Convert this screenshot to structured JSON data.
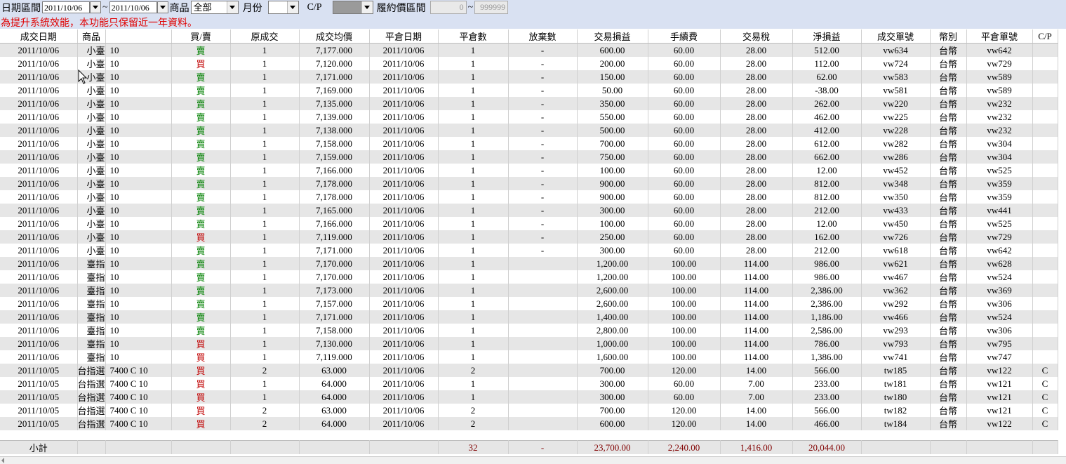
{
  "toolbar": {
    "date_range_label": "日期區間",
    "date_from": "2011/10/06",
    "tilde": "~",
    "date_to": "2011/10/06",
    "product_label": "商品",
    "product_value": "全部",
    "month_label": "月份",
    "month_value": "",
    "cp_label": "C/P",
    "cp_value": "",
    "strike_label": "履約價區間",
    "strike_from": "0",
    "strike_to": "999999"
  },
  "notice": "為提升系統效能，本功能只保留近一年資料。",
  "columns": [
    "成交日期",
    "商品",
    "",
    "買/賣",
    "原成交",
    "成交均價",
    "平倉日期",
    "平倉數",
    "放棄數",
    "交易損益",
    "手續費",
    "交易稅",
    "淨損益",
    "成交單號",
    "幣別",
    "平倉單號",
    "C/P"
  ],
  "rows": [
    [
      "2011/10/06",
      "小臺",
      "10",
      "賣",
      "1",
      "7,177.000",
      "2011/10/06",
      "1",
      "-",
      "600.00",
      "60.00",
      "28.00",
      "512.00",
      "vw634",
      "台幣",
      "vw642",
      ""
    ],
    [
      "2011/10/06",
      "小臺",
      "10",
      "買",
      "1",
      "7,120.000",
      "2011/10/06",
      "1",
      "-",
      "200.00",
      "60.00",
      "28.00",
      "112.00",
      "vw724",
      "台幣",
      "vw729",
      ""
    ],
    [
      "2011/10/06",
      "小臺",
      "10",
      "賣",
      "1",
      "7,171.000",
      "2011/10/06",
      "1",
      "-",
      "150.00",
      "60.00",
      "28.00",
      "62.00",
      "vw583",
      "台幣",
      "vw589",
      ""
    ],
    [
      "2011/10/06",
      "小臺",
      "10",
      "賣",
      "1",
      "7,169.000",
      "2011/10/06",
      "1",
      "-",
      "50.00",
      "60.00",
      "28.00",
      "-38.00",
      "vw581",
      "台幣",
      "vw589",
      ""
    ],
    [
      "2011/10/06",
      "小臺",
      "10",
      "賣",
      "1",
      "7,135.000",
      "2011/10/06",
      "1",
      "-",
      "350.00",
      "60.00",
      "28.00",
      "262.00",
      "vw220",
      "台幣",
      "vw232",
      ""
    ],
    [
      "2011/10/06",
      "小臺",
      "10",
      "賣",
      "1",
      "7,139.000",
      "2011/10/06",
      "1",
      "-",
      "550.00",
      "60.00",
      "28.00",
      "462.00",
      "vw225",
      "台幣",
      "vw232",
      ""
    ],
    [
      "2011/10/06",
      "小臺",
      "10",
      "賣",
      "1",
      "7,138.000",
      "2011/10/06",
      "1",
      "-",
      "500.00",
      "60.00",
      "28.00",
      "412.00",
      "vw228",
      "台幣",
      "vw232",
      ""
    ],
    [
      "2011/10/06",
      "小臺",
      "10",
      "賣",
      "1",
      "7,158.000",
      "2011/10/06",
      "1",
      "-",
      "700.00",
      "60.00",
      "28.00",
      "612.00",
      "vw282",
      "台幣",
      "vw304",
      ""
    ],
    [
      "2011/10/06",
      "小臺",
      "10",
      "賣",
      "1",
      "7,159.000",
      "2011/10/06",
      "1",
      "-",
      "750.00",
      "60.00",
      "28.00",
      "662.00",
      "vw286",
      "台幣",
      "vw304",
      ""
    ],
    [
      "2011/10/06",
      "小臺",
      "10",
      "賣",
      "1",
      "7,166.000",
      "2011/10/06",
      "1",
      "-",
      "100.00",
      "60.00",
      "28.00",
      "12.00",
      "vw452",
      "台幣",
      "vw525",
      ""
    ],
    [
      "2011/10/06",
      "小臺",
      "10",
      "賣",
      "1",
      "7,178.000",
      "2011/10/06",
      "1",
      "-",
      "900.00",
      "60.00",
      "28.00",
      "812.00",
      "vw348",
      "台幣",
      "vw359",
      ""
    ],
    [
      "2011/10/06",
      "小臺",
      "10",
      "賣",
      "1",
      "7,178.000",
      "2011/10/06",
      "1",
      "-",
      "900.00",
      "60.00",
      "28.00",
      "812.00",
      "vw350",
      "台幣",
      "vw359",
      ""
    ],
    [
      "2011/10/06",
      "小臺",
      "10",
      "賣",
      "1",
      "7,165.000",
      "2011/10/06",
      "1",
      "-",
      "300.00",
      "60.00",
      "28.00",
      "212.00",
      "vw433",
      "台幣",
      "vw441",
      ""
    ],
    [
      "2011/10/06",
      "小臺",
      "10",
      "賣",
      "1",
      "7,166.000",
      "2011/10/06",
      "1",
      "-",
      "100.00",
      "60.00",
      "28.00",
      "12.00",
      "vw450",
      "台幣",
      "vw525",
      ""
    ],
    [
      "2011/10/06",
      "小臺",
      "10",
      "買",
      "1",
      "7,119.000",
      "2011/10/06",
      "1",
      "-",
      "250.00",
      "60.00",
      "28.00",
      "162.00",
      "vw726",
      "台幣",
      "vw729",
      ""
    ],
    [
      "2011/10/06",
      "小臺",
      "10",
      "賣",
      "1",
      "7,171.000",
      "2011/10/06",
      "1",
      "-",
      "300.00",
      "60.00",
      "28.00",
      "212.00",
      "vw618",
      "台幣",
      "vw642",
      ""
    ],
    [
      "2011/10/06",
      "臺指",
      "10",
      "賣",
      "1",
      "7,170.000",
      "2011/10/06",
      "1",
      "",
      "1,200.00",
      "100.00",
      "114.00",
      "986.00",
      "vw621",
      "台幣",
      "vw628",
      ""
    ],
    [
      "2011/10/06",
      "臺指",
      "10",
      "賣",
      "1",
      "7,170.000",
      "2011/10/06",
      "1",
      "",
      "1,200.00",
      "100.00",
      "114.00",
      "986.00",
      "vw467",
      "台幣",
      "vw524",
      ""
    ],
    [
      "2011/10/06",
      "臺指",
      "10",
      "賣",
      "1",
      "7,173.000",
      "2011/10/06",
      "1",
      "",
      "2,600.00",
      "100.00",
      "114.00",
      "2,386.00",
      "vw362",
      "台幣",
      "vw369",
      ""
    ],
    [
      "2011/10/06",
      "臺指",
      "10",
      "賣",
      "1",
      "7,157.000",
      "2011/10/06",
      "1",
      "",
      "2,600.00",
      "100.00",
      "114.00",
      "2,386.00",
      "vw292",
      "台幣",
      "vw306",
      ""
    ],
    [
      "2011/10/06",
      "臺指",
      "10",
      "賣",
      "1",
      "7,171.000",
      "2011/10/06",
      "1",
      "",
      "1,400.00",
      "100.00",
      "114.00",
      "1,186.00",
      "vw466",
      "台幣",
      "vw524",
      ""
    ],
    [
      "2011/10/06",
      "臺指",
      "10",
      "賣",
      "1",
      "7,158.000",
      "2011/10/06",
      "1",
      "",
      "2,800.00",
      "100.00",
      "114.00",
      "2,586.00",
      "vw293",
      "台幣",
      "vw306",
      ""
    ],
    [
      "2011/10/06",
      "臺指",
      "10",
      "買",
      "1",
      "7,130.000",
      "2011/10/06",
      "1",
      "",
      "1,000.00",
      "100.00",
      "114.00",
      "786.00",
      "vw793",
      "台幣",
      "vw795",
      ""
    ],
    [
      "2011/10/06",
      "臺指",
      "10",
      "買",
      "1",
      "7,119.000",
      "2011/10/06",
      "1",
      "",
      "1,600.00",
      "100.00",
      "114.00",
      "1,386.00",
      "vw741",
      "台幣",
      "vw747",
      ""
    ],
    [
      "2011/10/05",
      "台指選",
      "7400 C 10",
      "買",
      "2",
      "63.000",
      "2011/10/06",
      "2",
      "",
      "700.00",
      "120.00",
      "14.00",
      "566.00",
      "tw185",
      "台幣",
      "vw122",
      "C"
    ],
    [
      "2011/10/05",
      "台指選",
      "7400 C 10",
      "買",
      "1",
      "64.000",
      "2011/10/06",
      "1",
      "",
      "300.00",
      "60.00",
      "7.00",
      "233.00",
      "tw181",
      "台幣",
      "vw121",
      "C"
    ],
    [
      "2011/10/05",
      "台指選",
      "7400 C 10",
      "買",
      "1",
      "64.000",
      "2011/10/06",
      "1",
      "",
      "300.00",
      "60.00",
      "7.00",
      "233.00",
      "tw180",
      "台幣",
      "vw121",
      "C"
    ],
    [
      "2011/10/05",
      "台指選",
      "7400 C 10",
      "買",
      "2",
      "63.000",
      "2011/10/06",
      "2",
      "",
      "700.00",
      "120.00",
      "14.00",
      "566.00",
      "tw182",
      "台幣",
      "vw121",
      "C"
    ],
    [
      "2011/10/05",
      "台指選",
      "7400 C 10",
      "買",
      "2",
      "64.000",
      "2011/10/06",
      "2",
      "",
      "600.00",
      "120.00",
      "14.00",
      "466.00",
      "tw184",
      "台幣",
      "vw122",
      "C"
    ]
  ],
  "subtotal": {
    "label": "小計",
    "close_qty": "32",
    "abandon": "-",
    "trade_pl": "23,700.00",
    "fee": "2,240.00",
    "tax": "1,416.00",
    "net_pl": "20,044.00"
  },
  "colors": {
    "sell": "#008000",
    "buy": "#c00000",
    "notice": "#e00000",
    "toolbar_bg": "#d9e1f2"
  }
}
